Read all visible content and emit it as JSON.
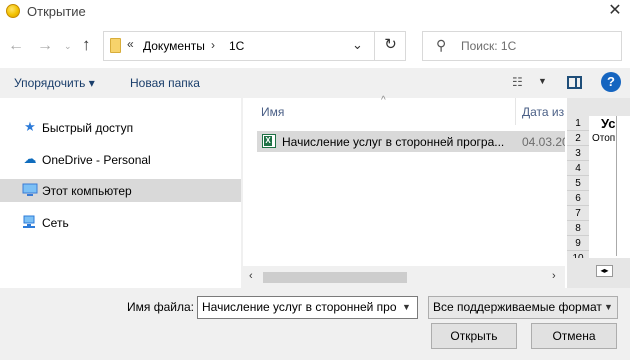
{
  "window": {
    "title": "Открытие",
    "close_glyph": "✕"
  },
  "nav": {
    "back_glyph": "←",
    "forward_glyph": "→",
    "recent_glyph": "⌄",
    "up_glyph": "↑",
    "address_prefix": "«",
    "breadcrumbs": [
      "Документы",
      "1С"
    ],
    "crumb_separator": "›",
    "refresh_glyph": "↻",
    "dropdown_glyph": "⌄",
    "search_placeholder": "Поиск: 1С"
  },
  "toolbar": {
    "organize_label": "Упорядочить ▾",
    "new_folder_label": "Новая папка",
    "views_glyph": "☷",
    "help_glyph": "?"
  },
  "sidebar": {
    "items": [
      {
        "label": "Быстрый доступ",
        "icon": "star-icon",
        "color": "#2d7bd8"
      },
      {
        "label": "OneDrive - Personal",
        "icon": "cloud-icon",
        "color": "#0f6cbd"
      },
      {
        "label": "Этот компьютер",
        "icon": "computer-icon",
        "color": "#3a7bd5",
        "selected": true
      },
      {
        "label": "Сеть",
        "icon": "network-icon",
        "color": "#2d7bd8"
      }
    ]
  },
  "filelist": {
    "columns": [
      "Имя",
      "Дата из"
    ],
    "sort_glyph": "^",
    "files": [
      {
        "name": "Начисление услуг в сторонней програ...",
        "date": "04.03.20",
        "icon": "excel-file-icon"
      }
    ]
  },
  "scrollbar": {
    "left_glyph": "‹",
    "right_glyph": "›"
  },
  "preview": {
    "row_numbers": [
      "1",
      "2",
      "3",
      "4",
      "5",
      "6",
      "7",
      "8",
      "9",
      "10"
    ],
    "cell_big": "Ус",
    "cell_small": "Отоп",
    "nav_glyph": "◂▸"
  },
  "bottom": {
    "filename_label": "Имя файла:",
    "filename_value": "Начисление услуг в сторонней про",
    "filter_value": "Все поддерживаемые формат",
    "open_label": "Открыть",
    "cancel_label": "Отмена"
  },
  "colors": {
    "accent": "#1565c0",
    "selection": "#d9d9d9",
    "link": "#1a3e6b"
  }
}
